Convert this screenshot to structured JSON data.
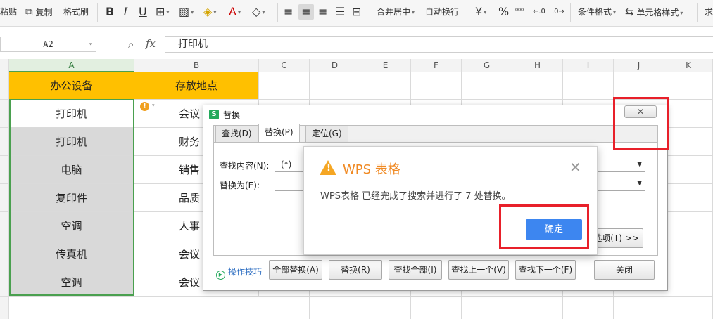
{
  "ribbon": {
    "paste": "粘贴",
    "copy": "复制",
    "format_painter": "格式刷",
    "merge_center": "合并居中",
    "auto_wrap": "自动换行",
    "currency_icon": "¥",
    "percent_icon": "%",
    "conditional_format": "条件格式",
    "cell_style": "单元格样式",
    "sum_partial": "求"
  },
  "formula_bar": {
    "name_box": "A2",
    "fx": "fx",
    "content": "打印机"
  },
  "columns": [
    "A",
    "B",
    "C",
    "D",
    "E",
    "F",
    "G",
    "H",
    "I",
    "J",
    "K"
  ],
  "table": {
    "headers": [
      "办公设备",
      "存放地点"
    ],
    "rows": [
      [
        "打印机",
        "会议"
      ],
      [
        "打印机",
        "财务"
      ],
      [
        "电脑",
        "销售"
      ],
      [
        "复印件",
        "品质"
      ],
      [
        "空调",
        "人事"
      ],
      [
        "传真机",
        "会议"
      ],
      [
        "空调",
        "会议"
      ]
    ]
  },
  "replace_dialog": {
    "title": "替换",
    "tabs": [
      "查找(D)",
      "替换(P)",
      "定位(G)"
    ],
    "find_label": "查找内容(N):",
    "find_value": "(*)",
    "replace_label": "替换为(E):",
    "replace_value": "",
    "options_button": "选项(T) >>",
    "tips": "操作技巧",
    "buttons": [
      "全部替换(A)",
      "替换(R)",
      "查找全部(I)",
      "查找上一个(V)",
      "查找下一个(F)",
      "关闭"
    ]
  },
  "message_box": {
    "title": "WPS 表格",
    "text": "WPS表格 已经完成了搜索并进行了 7 处替换。",
    "ok": "确定"
  },
  "colors": {
    "header_fill": "#ffc000",
    "selected_fill": "#d9d9d9",
    "selection_border": "#4aa04f",
    "highlight": "#e8202a",
    "ok_button": "#3d86f0",
    "title_orange": "#f08a24"
  }
}
